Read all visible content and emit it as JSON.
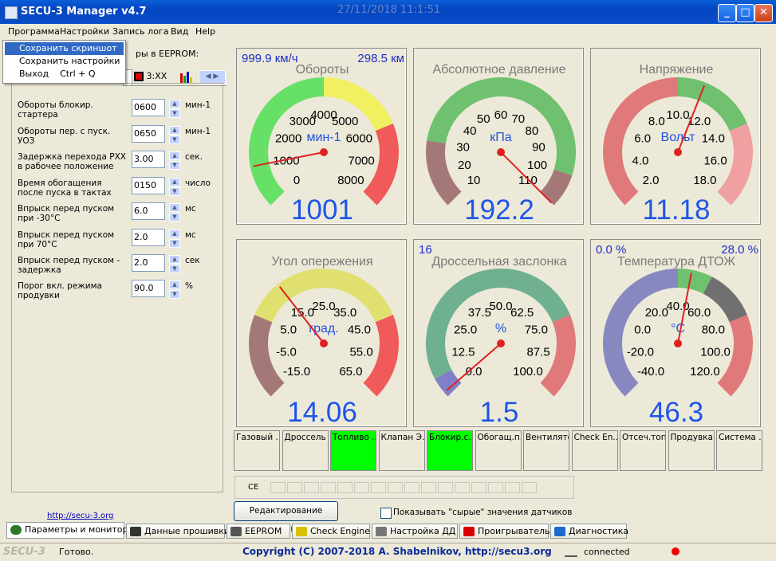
{
  "window": {
    "title": "SECU-3 Manager v4.7",
    "datetime": "27/11/2018 11:1:51"
  },
  "menu": {
    "items": [
      "Программа",
      "Настройки",
      "Запись лога",
      "Вид",
      "Help"
    ],
    "dropdown": [
      {
        "label": "Сохранить скриншот",
        "shortcut": ""
      },
      {
        "label": "Сохранить настройки",
        "shortcut": ""
      },
      {
        "label": "Выход",
        "shortcut": "Ctrl + Q"
      }
    ]
  },
  "left": {
    "eeprom_label": "ры в EEPROM:",
    "tab_label": "3:XX",
    "params": [
      {
        "label": "Обороты блокир. стартера",
        "value": "0600",
        "unit": "мин-1"
      },
      {
        "label": "Обороты пер. с пуск. УОЗ",
        "value": "0650",
        "unit": "мин-1"
      },
      {
        "label": "Задержка перехода РХХ в рабочее положение",
        "value": "3.00",
        "unit": "сек."
      },
      {
        "label": "Время обогащения после пуска в тактах",
        "value": "0150",
        "unit": "число"
      },
      {
        "label": "Впрыск перед пуском при -30°C",
        "value": "6.0",
        "unit": "мс"
      },
      {
        "label": "Впрыск перед пуском при 70°C",
        "value": "2.0",
        "unit": "мс"
      },
      {
        "label": "Впрыск перед пуском - задержка",
        "value": "2.0",
        "unit": "сек"
      },
      {
        "label": "Порог вкл. режима продувки",
        "value": "90.0",
        "unit": "%"
      }
    ],
    "link": "http://secu-3.org"
  },
  "gauges": [
    {
      "title": "Обороты",
      "unit": "мин-1",
      "value": "1001",
      "corner_left": "999.9 км/ч",
      "corner_right": "298.5 км",
      "ticks": [
        "0",
        "1000",
        "2000",
        "3000",
        "4000",
        "5000",
        "6000",
        "7000",
        "8000"
      ],
      "zones": [
        {
          "color": "#66e066",
          "from": 0,
          "to": 4
        },
        {
          "color": "#f0f060",
          "from": 4,
          "to": 6
        },
        {
          "color": "#f05a5a",
          "from": 6,
          "to": 8
        }
      ],
      "fraction": 0.125
    },
    {
      "title": "Абсолютное давление",
      "unit": "кПа",
      "value": "192.2",
      "corner_left": "",
      "corner_right": "",
      "ticks": [
        "10",
        "20",
        "30",
        "40",
        "50",
        "60",
        "70",
        "80",
        "90",
        "100",
        "110"
      ],
      "zones": [
        {
          "color": "#a57878",
          "from": 0,
          "to": 2
        },
        {
          "color": "#6fc06f",
          "from": 2,
          "to": 9
        },
        {
          "color": "#a57878",
          "from": 9,
          "to": 10
        }
      ],
      "fraction": 1.0
    },
    {
      "title": "Напряжение",
      "unit": "Вольт",
      "value": "11.18",
      "corner_left": "",
      "corner_right": "",
      "ticks": [
        "2.0",
        "4.0",
        "6.0",
        "8.0",
        "10.0",
        "12.0",
        "14.0",
        "16.0",
        "18.0"
      ],
      "zones": [
        {
          "color": "#e07a7a",
          "from": 0,
          "to": 4
        },
        {
          "color": "#6fc06f",
          "from": 4,
          "to": 6
        },
        {
          "color": "#f0a0a0",
          "from": 6,
          "to": 8
        }
      ],
      "fraction": 0.58
    },
    {
      "title": "Угол опережения",
      "unit": "град.",
      "value": "14.06",
      "corner_left": "",
      "corner_right": "",
      "ticks": [
        "-15.0",
        "-5.0",
        "5.0",
        "15.0",
        "25.0",
        "35.0",
        "45.0",
        "55.0",
        "65.0"
      ],
      "zones": [
        {
          "color": "#a57878",
          "from": 0,
          "to": 2
        },
        {
          "color": "#e0e070",
          "from": 2,
          "to": 6
        },
        {
          "color": "#f05a5a",
          "from": 6,
          "to": 8
        }
      ],
      "fraction": 0.36
    },
    {
      "title": "Дроссельная заслонка",
      "unit": "%",
      "value": "1.5",
      "corner_left": "16",
      "corner_right": "",
      "ticks": [
        "0.0",
        "12.5",
        "25.0",
        "37.5",
        "50.0",
        "62.5",
        "75.0",
        "87.5",
        "100.0"
      ],
      "zones": [
        {
          "color": "#8080c8",
          "from": 0,
          "to": 0.5
        },
        {
          "color": "#6fb090",
          "from": 0.5,
          "to": 6
        },
        {
          "color": "#e07a7a",
          "from": 6,
          "to": 8
        }
      ],
      "fraction": 0.015
    },
    {
      "title": "Температура ДТОЖ",
      "unit": "°C",
      "value": "46.3",
      "corner_left": "0.0 %",
      "corner_right": "28.0 %",
      "ticks": [
        "-40.0",
        "-20.0",
        "0.0",
        "20.0",
        "40.0",
        "60.0",
        "80.0",
        "100.0",
        "120.0"
      ],
      "zones": [
        {
          "color": "#8888c0",
          "from": 0,
          "to": 4
        },
        {
          "color": "#6fc06f",
          "from": 4,
          "to": 4.8
        },
        {
          "color": "#707070",
          "from": 4.8,
          "to": 6
        },
        {
          "color": "#e07a7a",
          "from": 6,
          "to": 8
        }
      ],
      "fraction": 0.54
    }
  ],
  "indicators": [
    {
      "label": "Газовый ...",
      "on": false
    },
    {
      "label": "Дроссель",
      "on": false
    },
    {
      "label": "Топливо ...",
      "on": true
    },
    {
      "label": "Клапан Э...",
      "on": false
    },
    {
      "label": "Блокир.с...",
      "on": true
    },
    {
      "label": "Обогащ.п...",
      "on": false
    },
    {
      "label": "Вентилятор",
      "on": false
    },
    {
      "label": "Check En...",
      "on": false
    },
    {
      "label": "Отсеч.топ...",
      "on": false
    },
    {
      "label": "Продувка...",
      "on": false
    },
    {
      "label": "Система ...",
      "on": false
    }
  ],
  "ce_label": "CE",
  "edit_tables_button": "Редактирование таблиц",
  "raw_values_checkbox": "Показывать \"сырые\" значения датчиков",
  "bottom_tabs": [
    "Параметры и монитор",
    "Данные прошивки",
    "EEPROM",
    "Check Engine",
    "Настройка ДД",
    "Проигрыватель",
    "Диагностика"
  ],
  "status": {
    "logo": "SECU-3",
    "ready": "Готово.",
    "copyright": "Copyright (C) 2007-2018 A. Shabelnikov, http://secu3.org",
    "connection": "connected"
  }
}
